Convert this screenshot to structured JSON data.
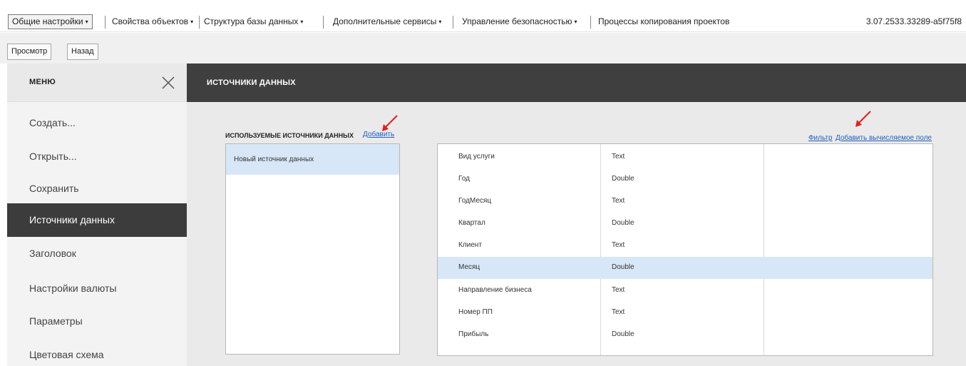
{
  "topmenu": {
    "items": [
      {
        "label": "Общие настройки",
        "caret": "▾"
      },
      {
        "label": "Свойства объектов",
        "caret": "▾"
      },
      {
        "label": "Структура базы данных",
        "caret": "▾"
      },
      {
        "label": "Дополнительные сервисы",
        "caret": "▾"
      },
      {
        "label": "Управление безопасностью",
        "caret": "▾"
      },
      {
        "label": "Процессы копирования проектов"
      }
    ],
    "version": "3.07.2533.33289-a5f75f8"
  },
  "toolbar": {
    "view_label": "Просмотр",
    "back_label": "Назад"
  },
  "sidebar": {
    "title": "МЕНЮ",
    "close_icon": "close-icon",
    "items": [
      {
        "label": "Создать..."
      },
      {
        "label": "Открыть..."
      },
      {
        "label": "Сохранить"
      },
      {
        "label": "Источники данных"
      },
      {
        "label": "Заголовок"
      },
      {
        "label": "Настройки валюты"
      },
      {
        "label": "Параметры"
      },
      {
        "label": "Цветовая схема"
      }
    ],
    "selected": "Источники данных"
  },
  "main": {
    "title": "ИСТОЧНИКИ ДАННЫХ",
    "used_sources_label": "ИСПОЛЬЗУЕМЫЕ ИСТОЧНИКИ ДАННЫХ",
    "add_link": "Добавить",
    "filter_link": "Фильтр",
    "add_calc_field_link": "Добавить вычисляемое поле",
    "sources": [
      {
        "name": "Новый источник данных"
      }
    ],
    "fields": [
      {
        "name": "Вид услуги",
        "type": "Text"
      },
      {
        "name": "Год",
        "type": "Double"
      },
      {
        "name": "ГодМесяц",
        "type": "Text"
      },
      {
        "name": "Квартал",
        "type": "Double"
      },
      {
        "name": "Клиент",
        "type": "Text"
      },
      {
        "name": "Месяц",
        "type": "Double"
      },
      {
        "name": "Направление бизнеса",
        "type": "Text"
      },
      {
        "name": "Номер ПП",
        "type": "Text"
      },
      {
        "name": "Прибыль",
        "type": "Double"
      }
    ],
    "selected_field": "Месяц"
  },
  "colors": {
    "accent_dark": "#3f3f3f",
    "selection": "#d8e7f7",
    "link": "#1e5fbf",
    "annotation_arrow": "#e02020"
  }
}
